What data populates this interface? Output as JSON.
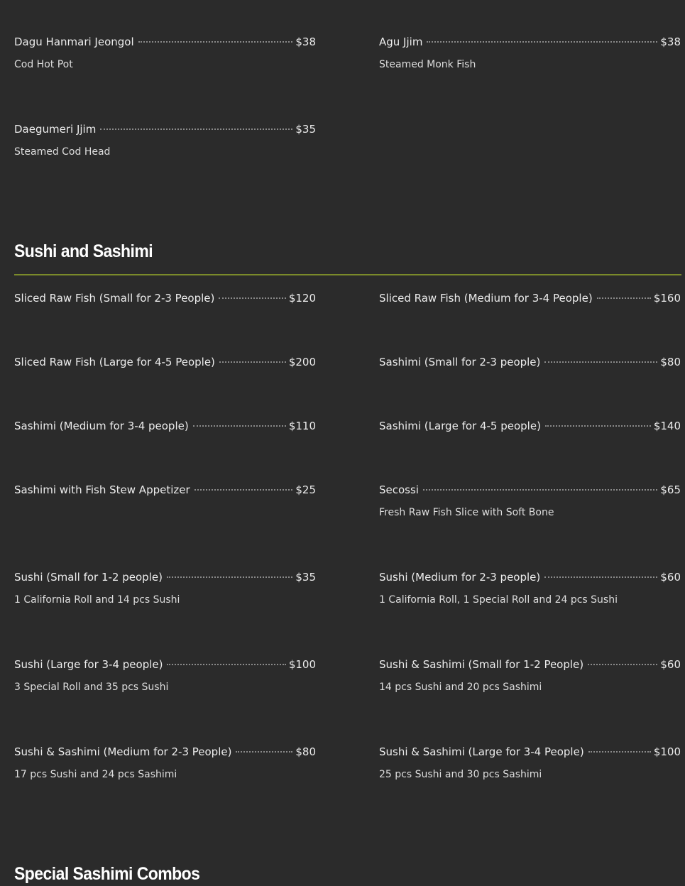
{
  "top_items": [
    {
      "name": "Dagu Hanmari Jeongol",
      "price": "$38",
      "desc": "Cod Hot Pot"
    },
    {
      "name": "Agu Jjim",
      "price": "$38",
      "desc": "Steamed Monk Fish"
    },
    {
      "name": "Daegumeri Jjim",
      "price": "$35",
      "desc": "Steamed Cod Head"
    }
  ],
  "sushi_section": {
    "title": "Sushi and Sashimi",
    "items": [
      {
        "name": "Sliced Raw Fish (Small for 2-3 People)",
        "price": "$120",
        "desc": ""
      },
      {
        "name": "Sliced Raw Fish (Medium for 3-4 People)",
        "price": "$160",
        "desc": ""
      },
      {
        "name": "Sliced Raw Fish (Large for 4-5 People)",
        "price": "$200",
        "desc": ""
      },
      {
        "name": "Sashimi (Small for 2-3 people)",
        "price": "$80",
        "desc": ""
      },
      {
        "name": "Sashimi (Medium for 3-4 people)",
        "price": "$110",
        "desc": ""
      },
      {
        "name": "Sashimi (Large for 4-5 people)",
        "price": "$140",
        "desc": ""
      },
      {
        "name": "Sashimi with Fish Stew Appetizer",
        "price": "$25",
        "desc": ""
      },
      {
        "name": "Secossi",
        "price": "$65",
        "desc": "Fresh Raw Fish Slice with Soft Bone"
      },
      {
        "name": "Sushi (Small for 1-2 people)",
        "price": "$35",
        "desc": "1 California Roll and 14 pcs Sushi"
      },
      {
        "name": "Sushi (Medium for 2-3 people)",
        "price": "$60",
        "desc": "1 California Roll, 1 Special Roll and 24 pcs Sushi"
      },
      {
        "name": "Sushi (Large for 3-4 people)",
        "price": "$100",
        "desc": "3 Special Roll and 35 pcs Sushi"
      },
      {
        "name": "Sushi & Sashimi (Small for 1-2 People)",
        "price": "$60",
        "desc": "14 pcs Sushi and 20 pcs Sashimi"
      },
      {
        "name": "Sushi & Sashimi (Medium for 2-3 People)",
        "price": "$80",
        "desc": "17 pcs Sushi and 24 pcs Sashimi"
      },
      {
        "name": "Sushi & Sashimi (Large for 3-4 People)",
        "price": "$100",
        "desc": "25 pcs Sushi and 30 pcs Sashimi"
      }
    ]
  },
  "combos_section": {
    "title": "Special Sashimi Combos"
  },
  "colors": {
    "background": "#2b2b2b",
    "divider": "#7a8a2a",
    "text": "#ececec"
  }
}
